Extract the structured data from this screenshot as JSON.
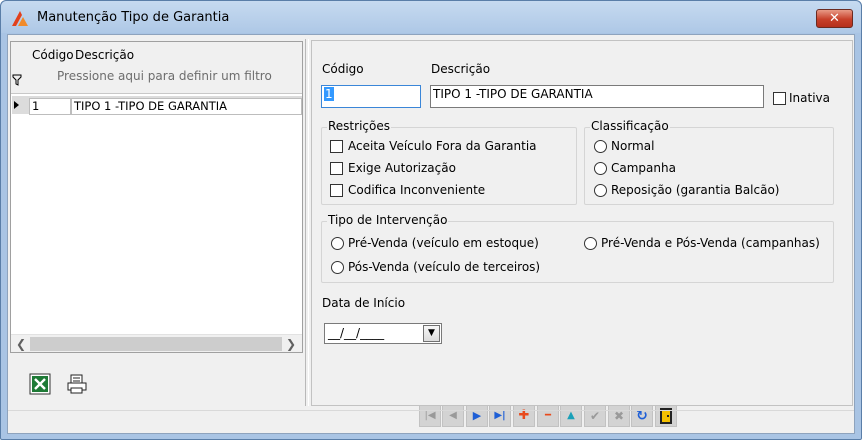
{
  "window": {
    "title": "Manutenção Tipo de Garantia",
    "close_label": "✕"
  },
  "grid": {
    "headers": {
      "codigo": "Código",
      "descricao": "Descrição"
    },
    "filter_hint": "Pressione aqui para definir um filtro",
    "rows": [
      {
        "codigo": "1",
        "descricao": "TIPO 1 -TIPO DE  GARANTIA"
      }
    ]
  },
  "form": {
    "codigo_label": "Código",
    "codigo_value": "1",
    "descricao_label": "Descrição",
    "descricao_value": "TIPO 1 -TIPO DE  GARANTIA",
    "inativa_label": "Inativa",
    "restricoes": {
      "title": "Restrições",
      "items": [
        "Aceita Veículo Fora da Garantia",
        "Exige Autorização",
        "Codifica Inconveniente"
      ]
    },
    "classificacao": {
      "title": "Classificação",
      "options": [
        "Normal",
        "Campanha",
        "Reposição (garantia Balcão)"
      ]
    },
    "tipo_intervencao": {
      "title": "Tipo de Intervenção",
      "options": [
        "Pré-Venda (veículo em estoque)",
        "Pré-Venda e Pós-Venda (campanhas)",
        "Pós-Venda (veículo de terceiros)"
      ]
    },
    "data_inicio_label": "Data de Início",
    "data_inicio_value": "__/__/____"
  },
  "toolbar": {
    "first": "|◀",
    "prev": "◀",
    "next": "▶",
    "last": "▶|",
    "add": "✚",
    "remove": "━",
    "up": "▲",
    "confirm": "✔",
    "cancel": "✖",
    "refresh": "↻"
  },
  "colors": {
    "nav_blue": "#1f5fd6",
    "add_red": "#e84a1c",
    "teal": "#1aa0b8",
    "disabled": "#9a9a9a",
    "exit_yellow": "#f4c000"
  }
}
